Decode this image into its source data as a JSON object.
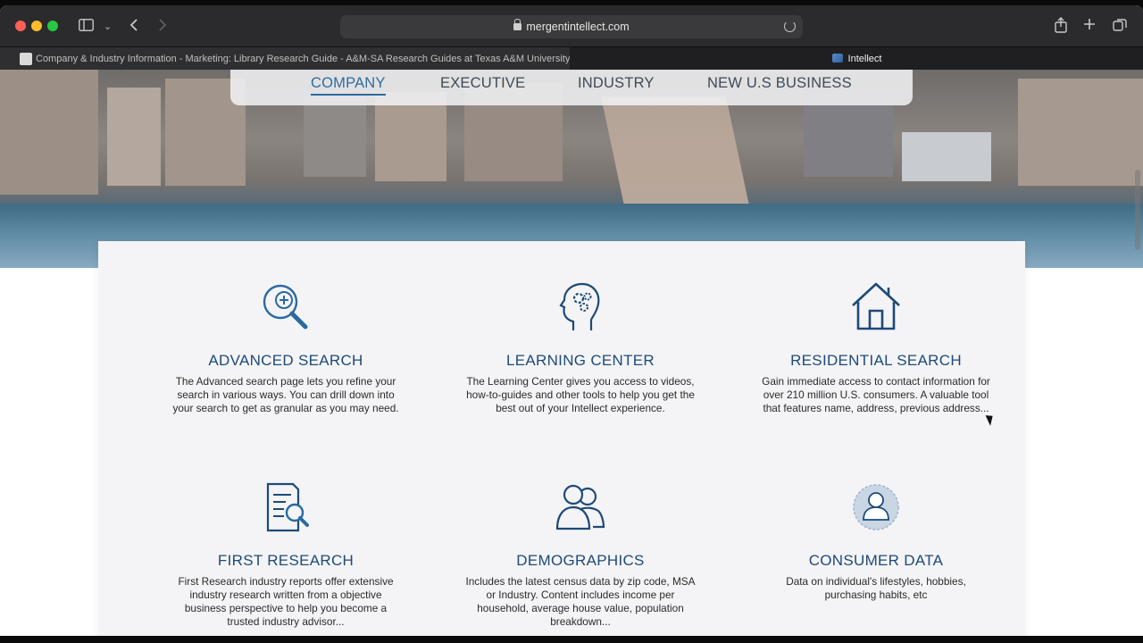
{
  "browser": {
    "address": "mergentintellect.com",
    "tabs": [
      {
        "label": "Company & Industry Information - Marketing: Library Research Guide - A&M-SA Research Guides at Texas A&M University-Sa..."
      },
      {
        "label": "Intellect"
      }
    ]
  },
  "nav": {
    "items": [
      {
        "label": "COMPANY",
        "active": true
      },
      {
        "label": "EXECUTIVE",
        "active": false
      },
      {
        "label": "INDUSTRY",
        "active": false
      },
      {
        "label": "NEW U.S BUSINESS",
        "active": false
      }
    ]
  },
  "features": [
    {
      "icon": "magnifier-plus-icon",
      "title": "ADVANCED SEARCH",
      "desc": "The Advanced search page lets you refine your search in various ways. You can drill down into your search to get as granular as you may need."
    },
    {
      "icon": "head-gears-icon",
      "title": "LEARNING CENTER",
      "desc": "The Learning Center gives you access to videos, how-to-guides and other tools to help you get the best out of your Intellect experience."
    },
    {
      "icon": "house-icon",
      "title": "RESIDENTIAL SEARCH",
      "desc": "Gain immediate access to contact information for over 210 million U.S. consumers. A valuable tool that features name, address, previous address..."
    },
    {
      "icon": "document-magnifier-icon",
      "title": "FIRST RESEARCH",
      "desc": "First Research industry reports offer extensive industry research written from a objective business perspective to help you become a trusted industry advisor..."
    },
    {
      "icon": "people-icon",
      "title": "DEMOGRAPHICS",
      "desc": "Includes the latest census data by zip code, MSA or Industry. Content includes income per household, average house value, population breakdown..."
    },
    {
      "icon": "consumer-person-icon",
      "title": "CONSUMER DATA",
      "desc": "Data on individual's lifestyles, hobbies, purchasing habits, etc"
    }
  ],
  "colors": {
    "accent": "#2c6ca0",
    "title": "#1e4a78"
  }
}
